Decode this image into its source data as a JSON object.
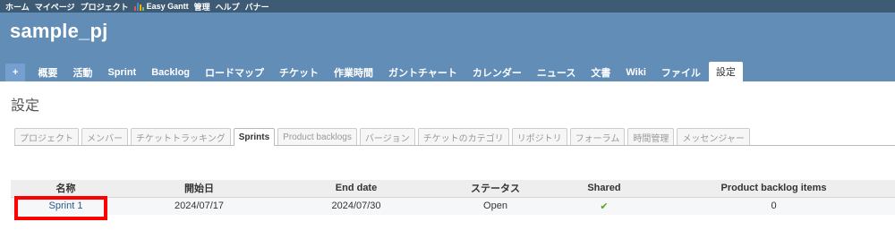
{
  "top_menu": {
    "items": [
      "ホーム",
      "マイページ",
      "プロジェクト",
      "Easy Gantt",
      "管理",
      "ヘルプ",
      "バナー"
    ],
    "gantt_icon_colors": [
      "#e8574a",
      "#3f8fd6",
      "#f0b400",
      "#7cbf4b"
    ]
  },
  "header": {
    "project_title": "sample_pj",
    "plus_label": "+",
    "main_menu": [
      "概要",
      "活動",
      "Sprint",
      "Backlog",
      "ロードマップ",
      "チケット",
      "作業時間",
      "ガントチャート",
      "カレンダー",
      "ニュース",
      "文書",
      "Wiki",
      "ファイル",
      "設定"
    ],
    "selected_index": 13
  },
  "page_title": "設定",
  "settings_tabs": {
    "items": [
      "プロジェクト",
      "メンバー",
      "チケットトラッキング",
      "Sprints",
      "Product backlogs",
      "バージョン",
      "チケットのカテゴリ",
      "リポジトリ",
      "フォーラム",
      "時間管理",
      "メッセンジャー"
    ],
    "selected_index": 3
  },
  "sprint_table": {
    "headers": [
      "名称",
      "開始日",
      "End date",
      "ステータス",
      "Shared",
      "Product backlog items"
    ],
    "rows": [
      {
        "name": "Sprint 1",
        "start_date": "2024/07/17",
        "end_date": "2024/07/30",
        "status": "Open",
        "shared_icon": "check-icon",
        "shared_glyph": "✔",
        "product_backlog_items": "0"
      }
    ]
  },
  "colors": {
    "top_bar": "#3e5b76",
    "header": "#628db6",
    "highlight": "#ff0000",
    "check": "#5aa02c"
  }
}
